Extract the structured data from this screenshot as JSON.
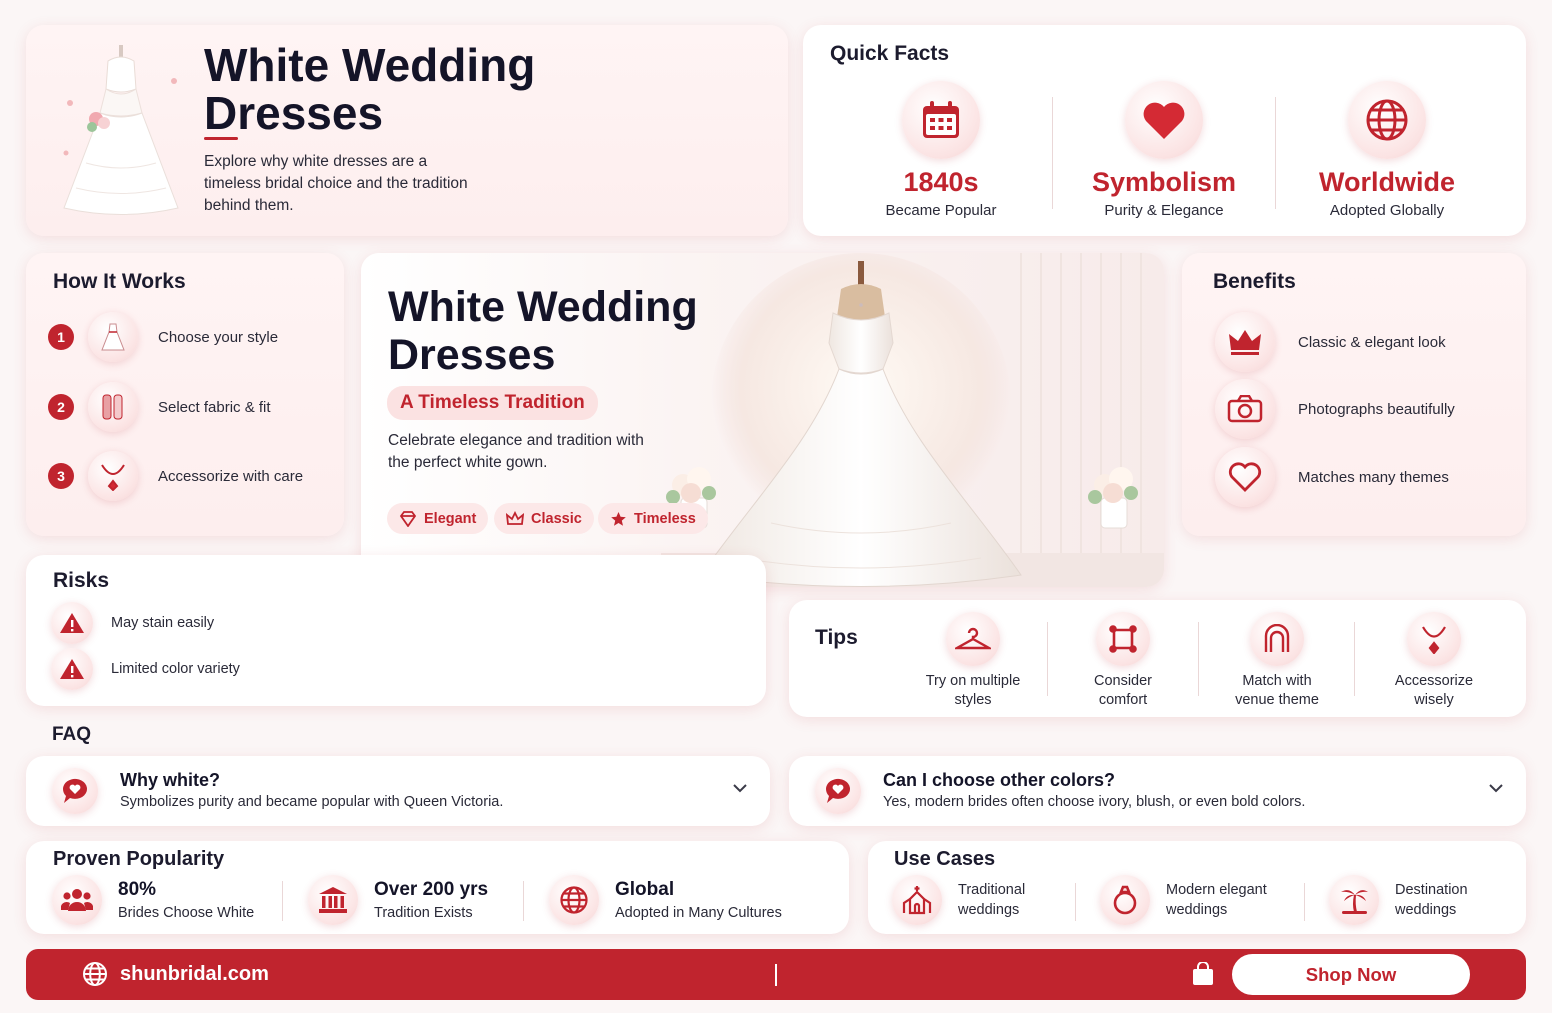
{
  "colors": {
    "accent": "#c0242e",
    "background": "#fbf6f6",
    "soft_pink": "#fbe2e2"
  },
  "hero": {
    "title_line1": "White Wedding",
    "title_line2": "Dresses",
    "description": "Explore why white dresses are a timeless bridal choice and the tradition behind them.",
    "image_icon": "wedding-dress-icon"
  },
  "quick_facts": {
    "title": "Quick Facts",
    "items": [
      {
        "icon": "calendar-icon",
        "value": "1840s",
        "label": "Became Popular"
      },
      {
        "icon": "heart-icon",
        "value": "Symbolism",
        "label": "Purity & Elegance"
      },
      {
        "icon": "globe-icon",
        "value": "Worldwide",
        "label": "Adopted Globally"
      }
    ]
  },
  "how_it_works": {
    "title": "How It Works",
    "steps": [
      {
        "num": "1",
        "icon": "dress-icon",
        "text": "Choose your style"
      },
      {
        "num": "2",
        "icon": "fabric-icon",
        "text": "Select fabric & fit"
      },
      {
        "num": "3",
        "icon": "necklace-icon",
        "text": "Accessorize with care"
      }
    ]
  },
  "feature": {
    "title_line1": "White Wedding",
    "title_line2": "Dresses",
    "subtitle": "A Timeless Tradition",
    "description": "Celebrate elegance and tradition with the perfect white gown.",
    "tags": [
      {
        "icon": "diamond-icon",
        "label": "Elegant"
      },
      {
        "icon": "crown-icon",
        "label": "Classic"
      },
      {
        "icon": "star-icon",
        "label": "Timeless"
      }
    ]
  },
  "benefits": {
    "title": "Benefits",
    "items": [
      {
        "icon": "crown-icon",
        "text": "Classic & elegant look"
      },
      {
        "icon": "camera-icon",
        "text": "Photographs beautifully"
      },
      {
        "icon": "heart-icon",
        "text": "Matches many themes"
      }
    ]
  },
  "risks": {
    "title": "Risks",
    "items": [
      {
        "icon": "warning-icon",
        "text": "May stain easily"
      },
      {
        "icon": "warning-icon",
        "text": "Limited color variety"
      }
    ]
  },
  "tips": {
    "title": "Tips",
    "items": [
      {
        "icon": "hanger-icon",
        "line1": "Try on multiple",
        "line2": "styles"
      },
      {
        "icon": "frame-icon",
        "line1": "Consider",
        "line2": "comfort"
      },
      {
        "icon": "arch-icon",
        "line1": "Match with",
        "line2": "venue theme"
      },
      {
        "icon": "necklace-icon",
        "line1": "Accessorize",
        "line2": "wisely"
      }
    ]
  },
  "faq": {
    "title": "FAQ",
    "items": [
      {
        "icon": "chat-heart-icon",
        "question": "Why white?",
        "answer": "Symbolizes purity and became popular with Queen Victoria."
      },
      {
        "icon": "chat-heart-icon",
        "question": "Can I choose other colors?",
        "answer": "Yes, modern brides often choose ivory, blush, or even bold colors."
      }
    ]
  },
  "popularity": {
    "title": "Proven Popularity",
    "stats": [
      {
        "icon": "people-icon",
        "value": "80%",
        "label": "Brides Choose White"
      },
      {
        "icon": "museum-icon",
        "value": "Over 200 yrs",
        "label": "Tradition Exists"
      },
      {
        "icon": "globe-icon",
        "value": "Global",
        "label": "Adopted in Many Cultures"
      }
    ]
  },
  "use_cases": {
    "title": "Use Cases",
    "items": [
      {
        "icon": "chapel-icon",
        "line1": "Traditional",
        "line2": "weddings"
      },
      {
        "icon": "ring-icon",
        "line1": "Modern elegant",
        "line2": "weddings"
      },
      {
        "icon": "palm-tree-icon",
        "line1": "Destination",
        "line2": "weddings"
      }
    ]
  },
  "footer": {
    "website": "shunbridal.com",
    "cta": "Shop Now"
  }
}
